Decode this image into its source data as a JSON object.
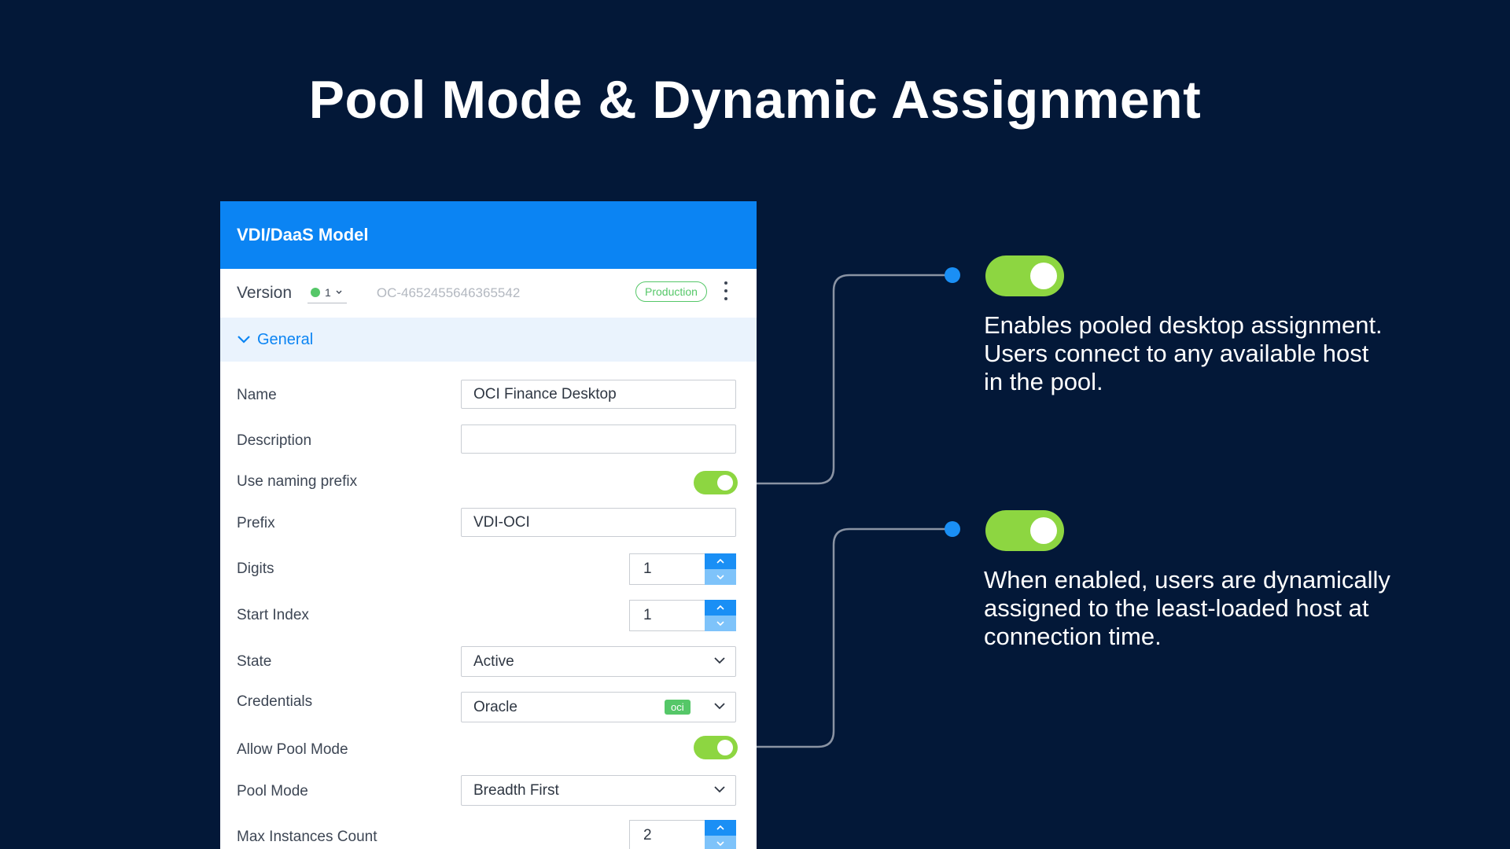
{
  "page": {
    "title": "Pool Mode & Dynamic Assignment"
  },
  "panel": {
    "header_title": "VDI/DaaS Model",
    "version": {
      "label": "Version",
      "value": "1",
      "id": "OC-4652455646365542",
      "badge": "Production",
      "status_color": "#55c768"
    },
    "section": {
      "label": "General",
      "icon": "chevron-down-icon"
    },
    "fields": {
      "name": {
        "label": "Name",
        "value": "OCI Finance Desktop"
      },
      "description": {
        "label": "Description",
        "value": ""
      },
      "use_naming_prefix": {
        "label": "Use naming prefix",
        "enabled": true
      },
      "prefix": {
        "label": "Prefix",
        "value": "VDI-OCI"
      },
      "digits": {
        "label": "Digits",
        "value": "1"
      },
      "start_index": {
        "label": "Start Index",
        "value": "1"
      },
      "state": {
        "label": "State",
        "value": "Active"
      },
      "credentials": {
        "label": "Credentials",
        "value": "Oracle",
        "tag": "oci"
      },
      "allow_pool_mode": {
        "label": "Allow Pool Mode",
        "enabled": true
      },
      "pool_mode": {
        "label": "Pool Mode",
        "value": "Breadth First"
      },
      "max_instances": {
        "label": "Max Instances Count",
        "value": "2"
      }
    }
  },
  "callouts": [
    {
      "toggle_enabled": true,
      "text": "Enables pooled desktop assignment. Users connect to any available host in the pool."
    },
    {
      "toggle_enabled": true,
      "text": "When enabled, users are dynamically assigned to the least-loaded host at connection time."
    }
  ],
  "colors": {
    "background": "#031838",
    "header_blue": "#0b84f3",
    "toggle_green": "#8dd641",
    "connector_dot": "#1a8ff5",
    "connector_line": "#8a93a3"
  }
}
